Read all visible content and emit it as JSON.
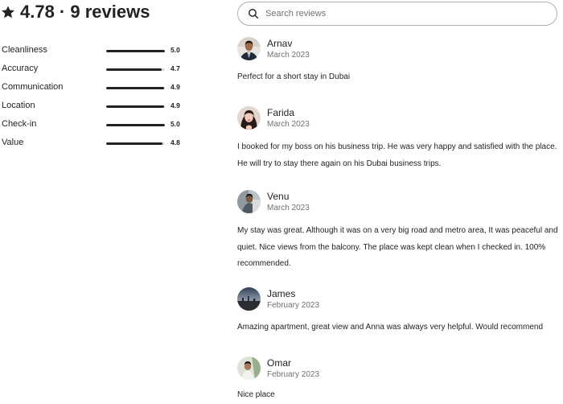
{
  "summary": {
    "heading": "4.78 · 9 reviews",
    "star_icon": "star-icon",
    "ratings": [
      {
        "label": "Cleanliness",
        "value": "5.0",
        "score": 5.0
      },
      {
        "label": "Accuracy",
        "value": "4.7",
        "score": 4.7
      },
      {
        "label": "Communication",
        "value": "4.9",
        "score": 4.9
      },
      {
        "label": "Location",
        "value": "4.9",
        "score": 4.9
      },
      {
        "label": "Check-in",
        "value": "5.0",
        "score": 5.0
      },
      {
        "label": "Value",
        "value": "4.8",
        "score": 4.8
      }
    ],
    "max_score": 5
  },
  "search": {
    "placeholder": "Search reviews",
    "value": "",
    "icon": "search-icon"
  },
  "reviews": [
    {
      "name": "Arnav",
      "date": "March 2023",
      "text": "Perfect for a short stay in Dubai"
    },
    {
      "name": "Farida",
      "date": "March 2023",
      "text": "I booked for my boss on his business trip. He was very happy and satisfied with the place. He will try to stay there again on his Dubai business trips."
    },
    {
      "name": "Venu",
      "date": "March 2023",
      "text": "My stay was great. Although it was on a very big road and metro area, It was peaceful and quiet. Nice views from the balcony. The place was kept clean when I checked in. 100% recommended."
    },
    {
      "name": "James",
      "date": "February 2023",
      "text": "Amazing apartment, great view and Anna was always very helpful. Would recommend"
    },
    {
      "name": "Omar",
      "date": "February 2023",
      "text": "Nice place"
    }
  ],
  "colors": {
    "text": "#222222",
    "muted": "#717171",
    "bar_fill": "#222222",
    "bar_track": "#dddddd",
    "search_border": "#b0b0b0"
  }
}
